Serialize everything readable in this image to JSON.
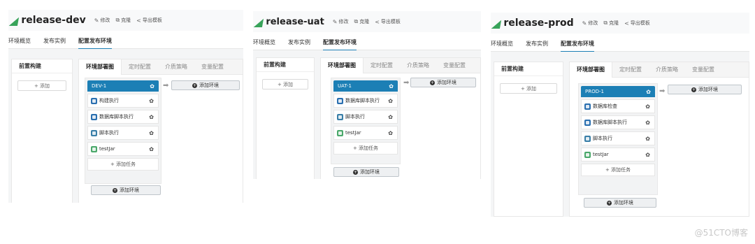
{
  "panels": [
    {
      "title": "release-dev",
      "actions": [
        {
          "icon": "edit-icon",
          "label": "修改"
        },
        {
          "icon": "copy-icon",
          "label": "克隆"
        },
        {
          "icon": "share-icon",
          "label": "导出模板"
        }
      ],
      "tabs": [
        "环境概览",
        "发布实例",
        "配置发布环境"
      ],
      "left_title": "前置构建",
      "add_label": "+ 添加",
      "right_tabs": [
        "环境部署图",
        "定时配置",
        "介质策略",
        "变量配置"
      ],
      "env_name": "DEV-1",
      "tasks": [
        {
          "label": "构建执行",
          "icon": "build-icon",
          "color": "#2a6fb0"
        },
        {
          "label": "数据库脚本执行",
          "icon": "database-icon",
          "color": "#2a6fb0"
        },
        {
          "label": "脚本执行",
          "icon": "script-icon",
          "color": "#3a7fa8"
        },
        {
          "label": "testJar",
          "icon": "jar-icon",
          "color": "#4aa86a"
        }
      ],
      "add_task": "+ 添加任务",
      "add_env": "添加环境"
    },
    {
      "title": "release-uat",
      "actions": [
        {
          "icon": "edit-icon",
          "label": "修改"
        },
        {
          "icon": "copy-icon",
          "label": "克隆"
        },
        {
          "icon": "share-icon",
          "label": "导出模板"
        }
      ],
      "tabs": [
        "环境概览",
        "发布实例",
        "配置发布环境"
      ],
      "left_title": "前置构建",
      "add_label": "+ 添加",
      "right_tabs": [
        "环境部署图",
        "定时配置",
        "介质策略",
        "变量配置"
      ],
      "env_name": "UAT-1",
      "tasks": [
        {
          "label": "数据库脚本执行",
          "icon": "database-icon",
          "color": "#2a6fb0"
        },
        {
          "label": "脚本执行",
          "icon": "script-icon",
          "color": "#3a7fa8"
        },
        {
          "label": "testJar",
          "icon": "jar-icon",
          "color": "#4aa86a"
        }
      ],
      "add_task": "+ 添加任务",
      "add_env": "添加环境"
    },
    {
      "title": "release-prod",
      "actions": [
        {
          "icon": "edit-icon",
          "label": "修改"
        },
        {
          "icon": "copy-icon",
          "label": "克隆"
        },
        {
          "icon": "share-icon",
          "label": "导出模板"
        }
      ],
      "tabs": [
        "环境概览",
        "发布实例",
        "配置发布环境"
      ],
      "left_title": "前置构建",
      "add_label": "+ 添加",
      "right_tabs": [
        "环境部署图",
        "定时配置",
        "介质策略",
        "变量配置"
      ],
      "env_name": "PROD-1",
      "tasks": [
        {
          "label": "数据库检查",
          "icon": "database-icon",
          "color": "#2a6fb0"
        },
        {
          "label": "数据库脚本执行",
          "icon": "database-icon",
          "color": "#2a6fb0"
        },
        {
          "label": "脚本执行",
          "icon": "script-icon",
          "color": "#3a7fa8"
        },
        {
          "label": "testJar",
          "icon": "jar-icon",
          "color": "#4aa86a"
        }
      ],
      "add_task": "+ 添加任务",
      "add_env": "添加环境"
    }
  ],
  "watermark": "@51CTO博客",
  "colors": {
    "accent": "#1c7fb5",
    "logo": "#38a35a"
  }
}
